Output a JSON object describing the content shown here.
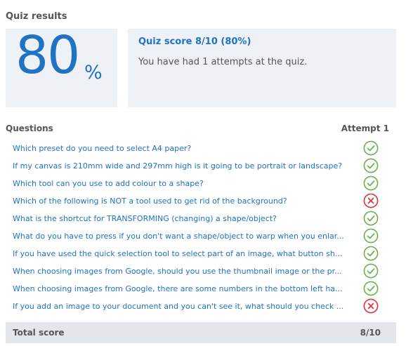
{
  "page": {
    "heading": "Quiz results"
  },
  "score": {
    "percent_value": "80",
    "percent_sign": "%"
  },
  "summary": {
    "title": "Quiz score 8/10 (80%)",
    "attempts_text": "You have had 1 attempts at the quiz."
  },
  "table": {
    "questions_header": "Questions",
    "attempt_header": "Attempt 1",
    "questions": [
      {
        "text": "Which preset do you need to select A4 paper?",
        "result": "correct",
        "icon": "check-circle-icon"
      },
      {
        "text": "If my canvas is 210mm wide and 297mm high is it going to be portrait or landscape?",
        "result": "correct",
        "icon": "check-circle-icon"
      },
      {
        "text": "Which tool can you use to add colour to a shape?",
        "result": "correct",
        "icon": "check-circle-icon"
      },
      {
        "text": "Which of the following is NOT a tool used to get rid of the background?",
        "result": "incorrect",
        "icon": "x-circle-icon"
      },
      {
        "text": "What is the shortcut for TRANSFORMING (changing) a shape/object?",
        "result": "correct",
        "icon": "check-circle-icon"
      },
      {
        "text": "What do you have to press if you don't want a shape/object to warp when you enlar...",
        "result": "correct",
        "icon": "check-circle-icon"
      },
      {
        "text": "If you have used the quick selection tool to select part of an image, what button sh...",
        "result": "correct",
        "icon": "check-circle-icon"
      },
      {
        "text": "When choosing images from Google, should you use the thumbnail image or the pr...",
        "result": "correct",
        "icon": "check-circle-icon"
      },
      {
        "text": "When choosing images from Google, there are some numbers in the bottom left ha...",
        "result": "correct",
        "icon": "check-circle-icon"
      },
      {
        "text": "If you add an image to your document and you can't see it, what should you check ...",
        "result": "incorrect",
        "icon": "x-circle-icon"
      }
    ],
    "total_label": "Total score",
    "total_value": "8/10"
  },
  "colors": {
    "accent": "#1f72c4",
    "correct": "#6ab04c",
    "incorrect": "#d9333f",
    "panel_bg": "#eef1f5",
    "total_bg": "#e3e6ea"
  }
}
